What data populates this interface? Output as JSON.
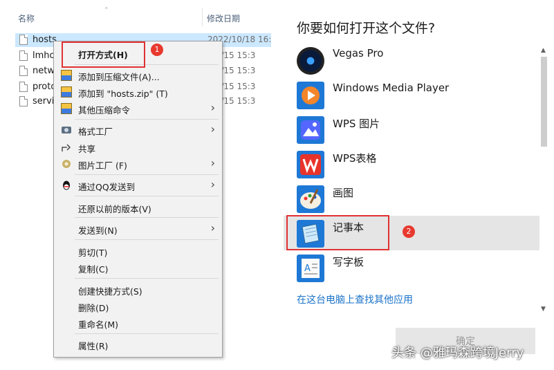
{
  "explorer": {
    "col_name": "名称",
    "col_date": "修改日期",
    "files": [
      {
        "name": "hosts",
        "date": "2022/10/18 16:",
        "selected": true
      },
      {
        "name": "lmho",
        "date": "8/9/15 15:3"
      },
      {
        "name": "netw",
        "date": "8/9/15 15:3"
      },
      {
        "name": "proto",
        "date": "8/9/15 15:3"
      },
      {
        "name": "servi",
        "date": "8/9/15 15:3"
      }
    ]
  },
  "context_menu": {
    "items": [
      {
        "label": "打开方式(H)",
        "icon": "none",
        "submenu": false
      },
      {
        "label": "添加到压缩文件(A)...",
        "icon": "winrar-icon",
        "submenu": false
      },
      {
        "label": "添加到 \"hosts.zip\" (T)",
        "icon": "winrar-icon",
        "submenu": false
      },
      {
        "label": "其他压缩命令",
        "icon": "winrar-icon",
        "submenu": true
      },
      {
        "label": "格式工厂",
        "icon": "format-factory-icon",
        "submenu": true
      },
      {
        "label": "共享",
        "icon": "share-icon",
        "submenu": false
      },
      {
        "label": "图片工厂 (F)",
        "icon": "picture-factory-icon",
        "submenu": true
      },
      {
        "label": "通过QQ发送到",
        "icon": "qq-icon",
        "submenu": true
      },
      {
        "label": "还原以前的版本(V)",
        "icon": "none",
        "submenu": false
      },
      {
        "label": "发送到(N)",
        "icon": "none",
        "submenu": true
      },
      {
        "label": "剪切(T)",
        "icon": "none",
        "submenu": false
      },
      {
        "label": "复制(C)",
        "icon": "none",
        "submenu": false
      },
      {
        "label": "创建快捷方式(S)",
        "icon": "none",
        "submenu": false
      },
      {
        "label": "删除(D)",
        "icon": "none",
        "submenu": false
      },
      {
        "label": "重命名(M)",
        "icon": "none",
        "submenu": false
      },
      {
        "label": "属性(R)",
        "icon": "none",
        "submenu": false
      }
    ],
    "badge": "1"
  },
  "open_with": {
    "title": "你要如何打开这个文件?",
    "apps": [
      {
        "name": "Vegas Pro",
        "icon": "vegas-pro-icon"
      },
      {
        "name": "Windows Media Player",
        "icon": "windows-media-player-icon"
      },
      {
        "name": "WPS 图片",
        "icon": "wps-picture-icon"
      },
      {
        "name": "WPS表格",
        "icon": "wps-spreadsheet-icon"
      },
      {
        "name": "画图",
        "icon": "paint-icon"
      },
      {
        "name": "记事本",
        "icon": "notepad-icon",
        "selected": true
      },
      {
        "name": "写字板",
        "icon": "wordpad-icon"
      }
    ],
    "badge": "2",
    "more_apps_link": "在这台电脑上查找其他应用",
    "ok_button": "确定"
  },
  "watermark": "头条 @雅玛森跨境Jerry",
  "colors": {
    "highlight_box": "#e03131",
    "badge": "#e8392f",
    "link": "#1a73c8",
    "selection": "#cce8ff"
  }
}
